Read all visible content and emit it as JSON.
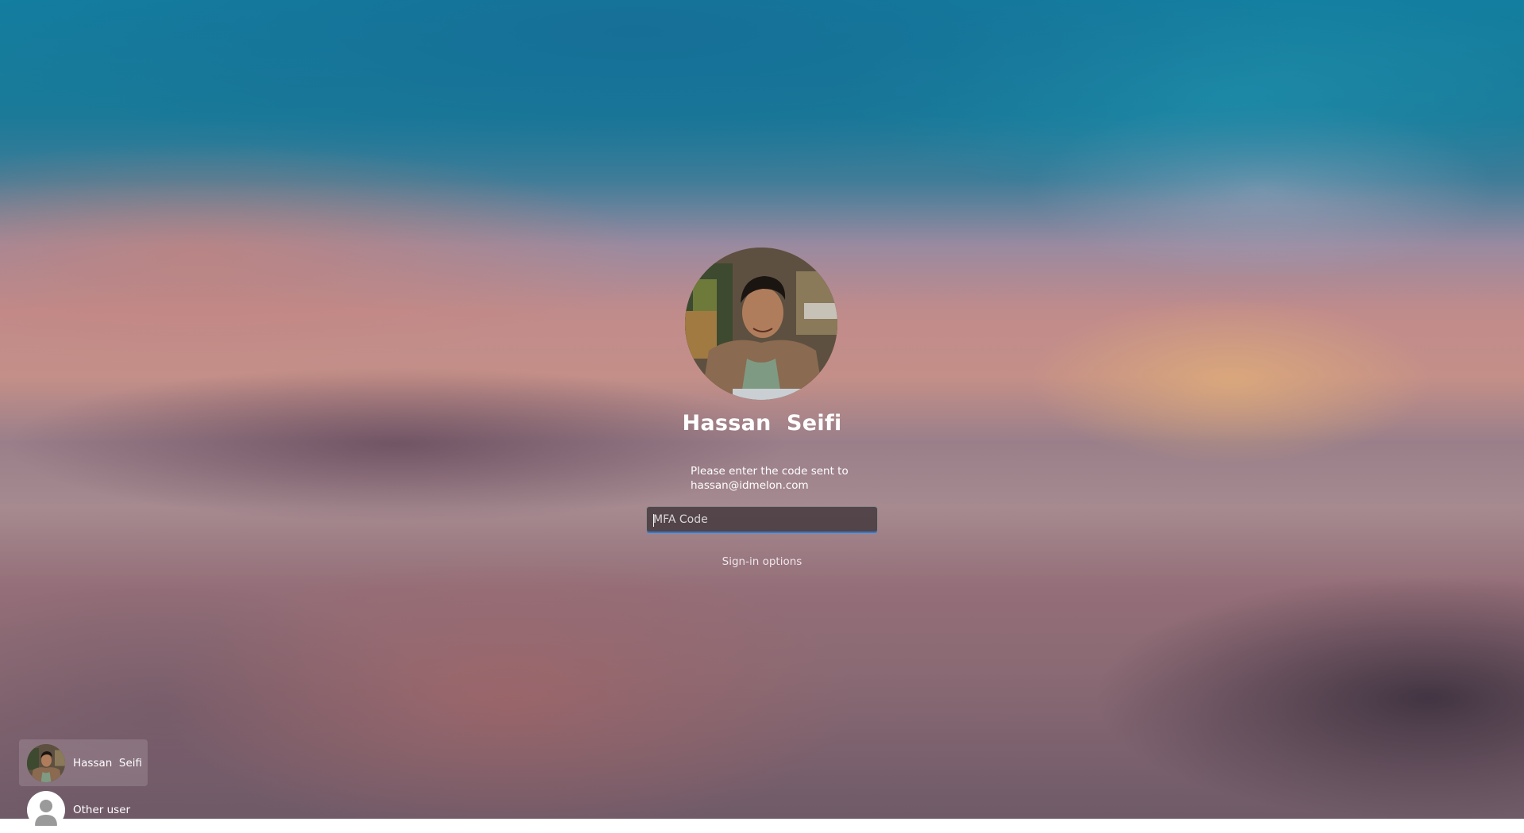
{
  "lock_screen": {
    "user_name": "Hassan  Seifi",
    "prompt_line1": "Please enter the code sent to",
    "prompt_line2": "hassan@idmelon.com",
    "mfa_placeholder": "MFA Code",
    "mfa_value": "",
    "signin_options_label": "Sign-in options"
  },
  "user_list": {
    "users": [
      {
        "label": "Hassan  Seifi",
        "icon": "user-photo",
        "selected": true
      },
      {
        "label": "Other user",
        "icon": "person-icon",
        "selected": false
      }
    ]
  },
  "colors": {
    "accent": "#2a7ed6",
    "text": "#ffffff"
  }
}
